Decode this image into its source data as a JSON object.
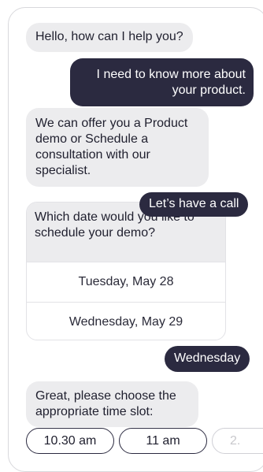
{
  "messages": [
    {
      "from": "bot",
      "text": "Hello, how can I help you?"
    },
    {
      "from": "user",
      "text": "I need to know more about your product."
    },
    {
      "from": "bot",
      "text": "We can offer you a Product demo or Schedule a consultation with our specialist."
    },
    {
      "from": "user",
      "text": "Let’s have a call"
    },
    {
      "from": "bot",
      "text": "Which date would you like to schedule your demo?"
    },
    {
      "from": "user",
      "text": "Wednesday"
    },
    {
      "from": "bot",
      "text": "Great, please choose the appropriate time slot:"
    }
  ],
  "date_options": [
    "Tuesday, May 28",
    "Wednesday, May 29"
  ],
  "time_slots": [
    "10.30 am",
    "11 am",
    "2."
  ],
  "colors": {
    "user_bubble": "#2b2a40",
    "bot_bubble": "#ececee",
    "border": "#d8d8dc"
  }
}
